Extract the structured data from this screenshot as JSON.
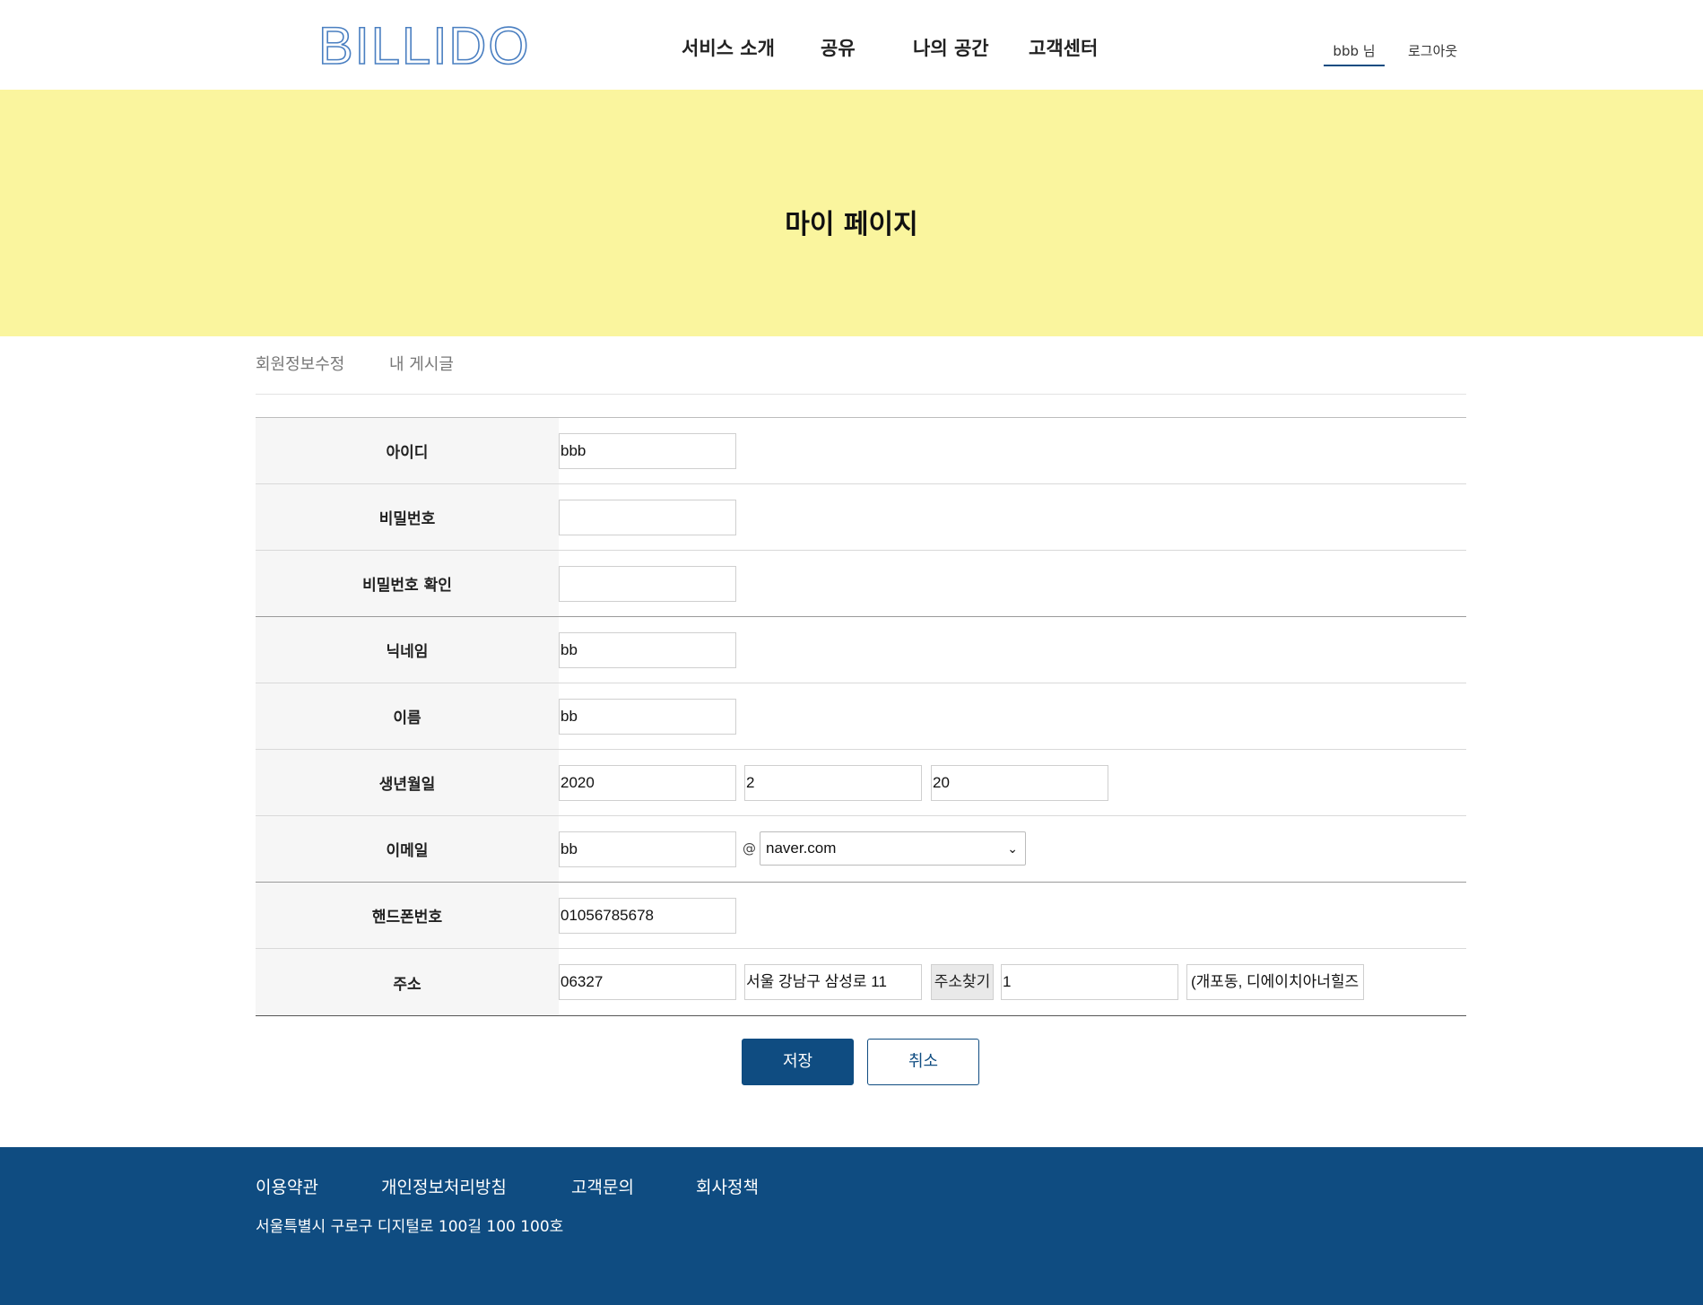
{
  "header": {
    "logo": "BILLIDO",
    "nav": [
      "서비스 소개",
      "공유",
      "나의 공간",
      "고객센터"
    ],
    "user_name": "bbb 님",
    "logout": "로그아웃"
  },
  "banner": {
    "title": "마이 페이지"
  },
  "tabs": [
    "회원정보수정",
    "내 게시글"
  ],
  "form": {
    "id": {
      "label": "아이디",
      "value": "bbb"
    },
    "password": {
      "label": "비밀번호",
      "value": ""
    },
    "password_confirm": {
      "label": "비밀번호 확인",
      "value": ""
    },
    "nickname": {
      "label": "닉네임",
      "value": "bb"
    },
    "name": {
      "label": "이름",
      "value": "bb"
    },
    "birth": {
      "label": "생년월일",
      "year": "2020",
      "month": "2",
      "day": "20"
    },
    "email": {
      "label": "이메일",
      "local": "bb",
      "at": "@",
      "domain": "naver.com"
    },
    "phone": {
      "label": "핸드폰번호",
      "value": "01056785678"
    },
    "address": {
      "label": "주소",
      "zipcode": "06327",
      "road": "서울 강남구 삼성로 11",
      "search_button": "주소찾기",
      "detail": "1",
      "extra": "(개포동, 디에이치아너힐즈"
    }
  },
  "buttons": {
    "save": "저장",
    "cancel": "취소"
  },
  "footer": {
    "links": [
      "이용약관",
      "개인정보처리방침",
      "고객문의",
      "회사정책"
    ],
    "address": "서울특별시 구로구 디지털로 100길 100 100호"
  },
  "colors": {
    "primary": "#0f4c81",
    "banner": "#faf59e",
    "logo": "#4a7fc1"
  }
}
